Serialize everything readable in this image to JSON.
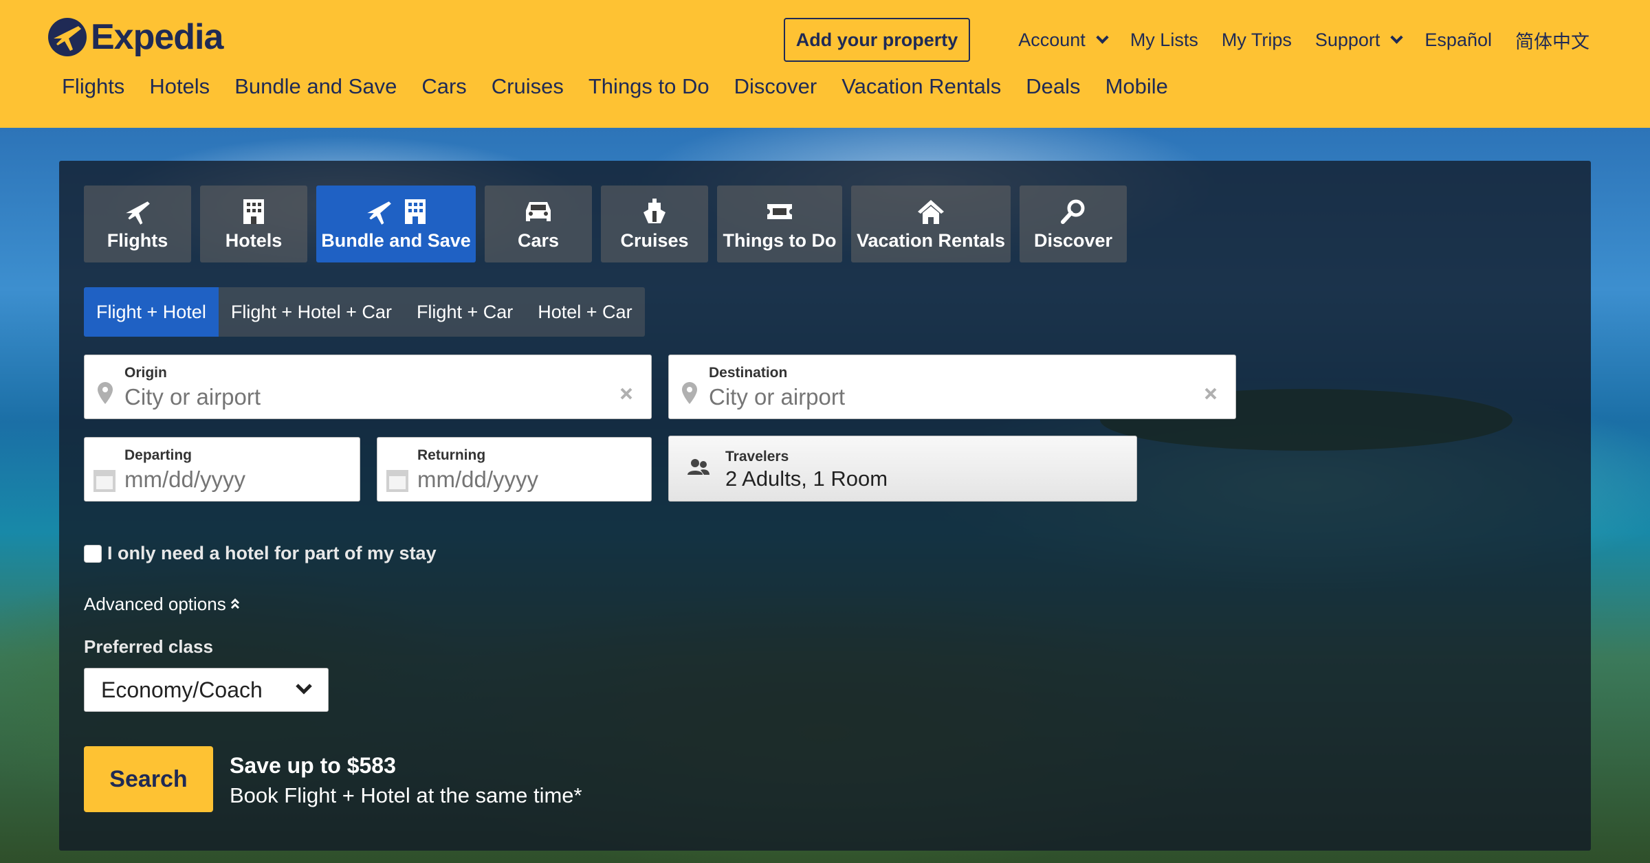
{
  "header": {
    "logo_text": "Expedia",
    "add_property": "Add your property",
    "links": {
      "account": "Account",
      "my_lists": "My Lists",
      "my_trips": "My Trips",
      "support": "Support",
      "espanol": "Español",
      "chinese": "简体中文"
    },
    "nav": [
      "Flights",
      "Hotels",
      "Bundle and Save",
      "Cars",
      "Cruises",
      "Things to Do",
      "Discover",
      "Vacation Rentals",
      "Deals",
      "Mobile"
    ]
  },
  "search": {
    "tabs": [
      {
        "label": "Flights",
        "icon": "plane-icon"
      },
      {
        "label": "Hotels",
        "icon": "building-icon"
      },
      {
        "label": "Bundle and Save",
        "icon": "plane-building-icon",
        "active": true
      },
      {
        "label": "Cars",
        "icon": "car-icon"
      },
      {
        "label": "Cruises",
        "icon": "ship-icon"
      },
      {
        "label": "Things to Do",
        "icon": "ticket-icon"
      },
      {
        "label": "Vacation Rentals",
        "icon": "house-icon"
      },
      {
        "label": "Discover",
        "icon": "search-icon"
      }
    ],
    "subtabs": [
      "Flight + Hotel",
      "Flight + Hotel + Car",
      "Flight + Car",
      "Hotel + Car"
    ],
    "origin": {
      "label": "Origin",
      "placeholder": "City or airport"
    },
    "destination": {
      "label": "Destination",
      "placeholder": "City or airport"
    },
    "departing": {
      "label": "Departing",
      "placeholder": "mm/dd/yyyy"
    },
    "returning": {
      "label": "Returning",
      "placeholder": "mm/dd/yyyy"
    },
    "travelers": {
      "label": "Travelers",
      "value": "2 Adults, 1 Room"
    },
    "partial_stay": "I only need a hotel for part of my stay",
    "advanced_options": "Advanced options",
    "preferred_class_label": "Preferred class",
    "preferred_class_value": "Economy/Coach",
    "search_button": "Search",
    "promo_title": "Save up to $583",
    "promo_subtitle": "Book Flight + Hotel at the same time*"
  },
  "colors": {
    "header_bg": "#fec233",
    "brand_navy": "#1f2a55",
    "active_tab": "#1f61c4"
  }
}
